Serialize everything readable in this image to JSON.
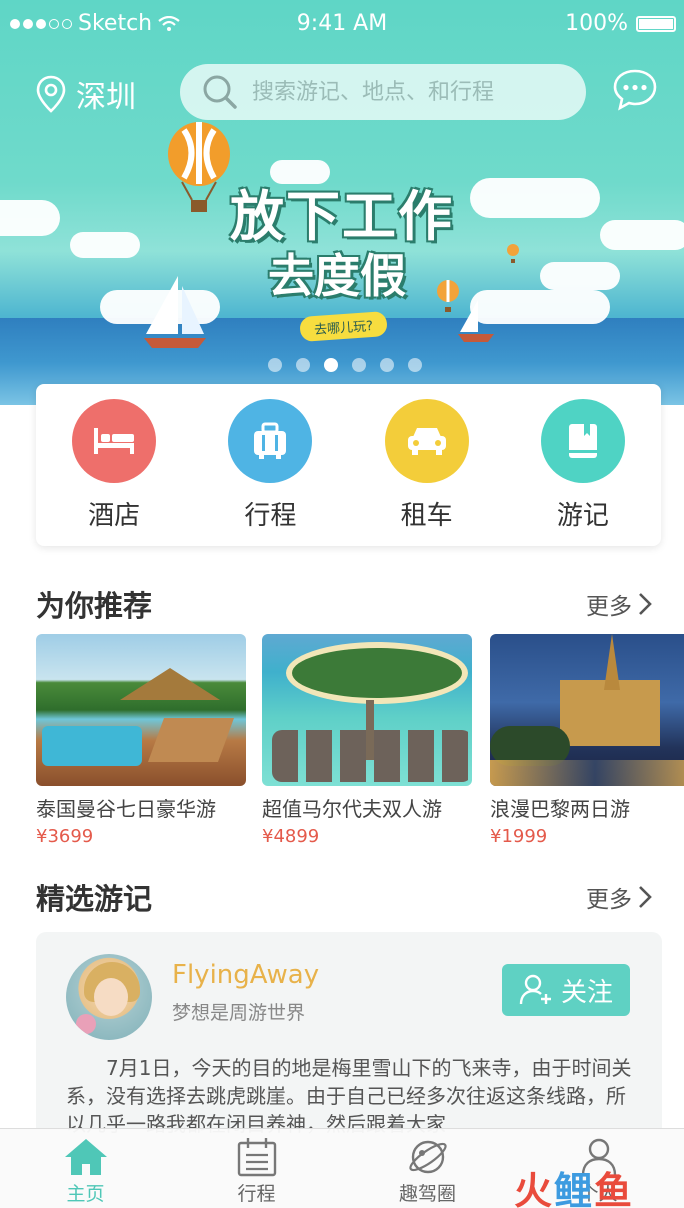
{
  "status_bar": {
    "carrier": "Sketch",
    "time": "9:41 AM",
    "battery": "100%"
  },
  "header": {
    "city": "深圳",
    "search_placeholder": "搜索游记、地点、和行程"
  },
  "banner": {
    "headline_line1": "放下工作",
    "headline_line2": "去度假",
    "badge": "去哪儿玩?",
    "pager_count": 6,
    "pager_active": 2
  },
  "categories": [
    {
      "label": "酒店",
      "icon": "bed-icon",
      "color": "#ee6f6b"
    },
    {
      "label": "行程",
      "icon": "luggage-icon",
      "color": "#4fb4e4"
    },
    {
      "label": "租车",
      "icon": "car-icon",
      "color": "#f3cd3a"
    },
    {
      "label": "游记",
      "icon": "book-icon",
      "color": "#4fd3c4"
    }
  ],
  "recommend": {
    "title": "为你推荐",
    "more": "更多",
    "items": [
      {
        "name": "泰国曼谷七日豪华游",
        "price": "¥3699"
      },
      {
        "name": "超值马尔代夫双人游",
        "price": "¥4899"
      },
      {
        "name": "浪漫巴黎两日游",
        "price": "¥1999"
      }
    ]
  },
  "notes": {
    "title": "精选游记",
    "more": "更多",
    "card": {
      "username": "FlyingAway",
      "signature": "梦想是周游世界",
      "follow_label": "关注",
      "text": "7月1日，今天的目的地是梅里雪山下的飞来寺，由于时间关系，没有选择去跳虎跳崖。由于自己已经多次往返这条线路，所以几乎一路我都在闭目养神，然后跟着大家"
    }
  },
  "tabbar": [
    {
      "label": "主页",
      "icon": "home-icon",
      "active": true
    },
    {
      "label": "行程",
      "icon": "calendar-icon",
      "active": false
    },
    {
      "label": "趣驾圈",
      "icon": "planet-icon",
      "active": false
    },
    {
      "label": "个人",
      "icon": "person-icon",
      "active": false
    }
  ],
  "watermark": {
    "a": "火",
    "b": "鲤",
    "c": "鱼"
  },
  "colors": {
    "accent": "#4fc7b7",
    "price": "#e45a4b",
    "username": "#e8b24a"
  }
}
